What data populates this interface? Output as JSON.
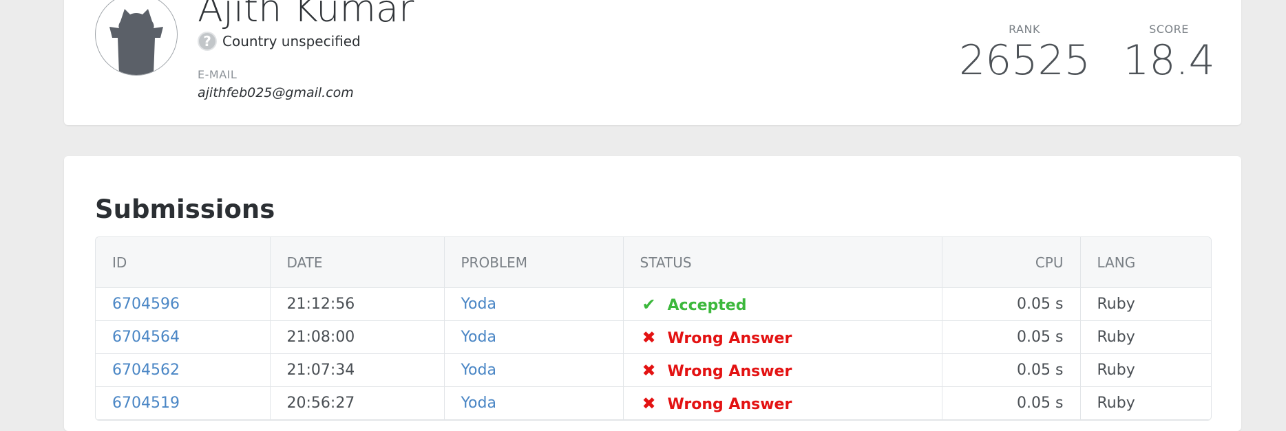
{
  "profile": {
    "name": "Ajith Kumar",
    "country": "Country unspecified",
    "email_label": "E-MAIL",
    "email": "ajithfeb025@gmail.com",
    "rank_label": "RANK",
    "rank": "26525",
    "score_label": "SCORE",
    "score": "18.4"
  },
  "submissions": {
    "title": "Submissions",
    "columns": {
      "id": "ID",
      "date": "DATE",
      "problem": "PROBLEM",
      "status": "STATUS",
      "cpu": "CPU",
      "lang": "LANG"
    },
    "rows": [
      {
        "id": "6704596",
        "date": "21:12:56",
        "problem": "Yoda",
        "status": "Accepted",
        "cpu": "0.05 s",
        "lang": "Ruby"
      },
      {
        "id": "6704564",
        "date": "21:08:00",
        "problem": "Yoda",
        "status": "Wrong Answer",
        "cpu": "0.05 s",
        "lang": "Ruby"
      },
      {
        "id": "6704562",
        "date": "21:07:34",
        "problem": "Yoda",
        "status": "Wrong Answer",
        "cpu": "0.05 s",
        "lang": "Ruby"
      },
      {
        "id": "6704519",
        "date": "20:56:27",
        "problem": "Yoda",
        "status": "Wrong Answer",
        "cpu": "0.05 s",
        "lang": "Ruby"
      }
    ]
  },
  "colors": {
    "accepted": "#3cb83c",
    "wrong": "#e31212",
    "link": "#4a86c5"
  },
  "icons": {
    "accepted": "check-icon",
    "wrong": "cross-icon",
    "country": "question-mark-icon",
    "avatar": "user-avatar-silhouette"
  }
}
